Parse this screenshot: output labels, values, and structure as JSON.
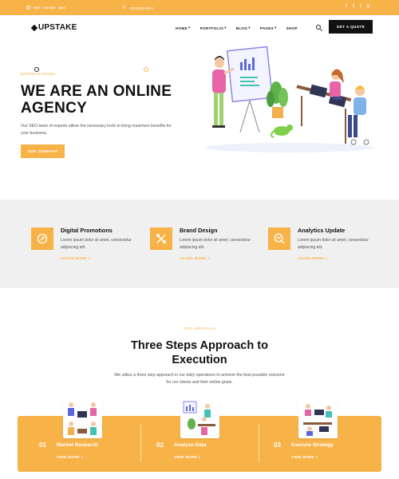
{
  "topbar": {
    "hours": "Mon - Sat 8am - 8pm",
    "phone": "+(234)815-8084",
    "socials": [
      "f",
      "t",
      "i",
      "y"
    ]
  },
  "header": {
    "logo": "UPSTAKE",
    "nav": [
      "HOME",
      "PORTFOLIO",
      "BLOG",
      "PAGES",
      "SHOP"
    ],
    "quote_button": "GET A QUOTE"
  },
  "hero": {
    "eyebrow": "BUSINESS MODEL",
    "title": "WE ARE AN ONLINE AGENCY",
    "description": "Our SEO team of experts utilize the necessary tools to bring maximum benefits for your business.",
    "button": "OUR COMPANY"
  },
  "features": [
    {
      "title": "Digital Promotions",
      "text": "Lorem ipsum dolor sit amet, consectetur adipiscing elit.",
      "link": "LEARN MORE >",
      "icon": "megaphone-icon"
    },
    {
      "title": "Brand Design",
      "text": "Lorem ipsum dolor sit amet, consectetur adipiscing elit.",
      "link": "LEARN MORE >",
      "icon": "design-tools-icon"
    },
    {
      "title": "Analytics Update",
      "text": "Lorem ipsum dolor sit amet, consectetur adipiscing elit.",
      "link": "LEARN MORE >",
      "icon": "analytics-icon"
    }
  ],
  "approach": {
    "eyebrow": "OUR APPROACH",
    "title": "Three Steps Approach to Execution",
    "description": "We utilize a three step approach in our daily operations to achieve the best possible outcome for our clients and their online goals.",
    "steps": [
      {
        "num": "01",
        "title": "Market Research",
        "link": "VIEW MORE >"
      },
      {
        "num": "02",
        "title": "Analyze Data",
        "link": "VIEW MORE >"
      },
      {
        "num": "03",
        "title": "Execute Strategy",
        "link": "VIEW MORE >"
      }
    ]
  },
  "colors": {
    "accent": "#f7b248",
    "dark": "#111111",
    "band": "#f0f0f0"
  }
}
